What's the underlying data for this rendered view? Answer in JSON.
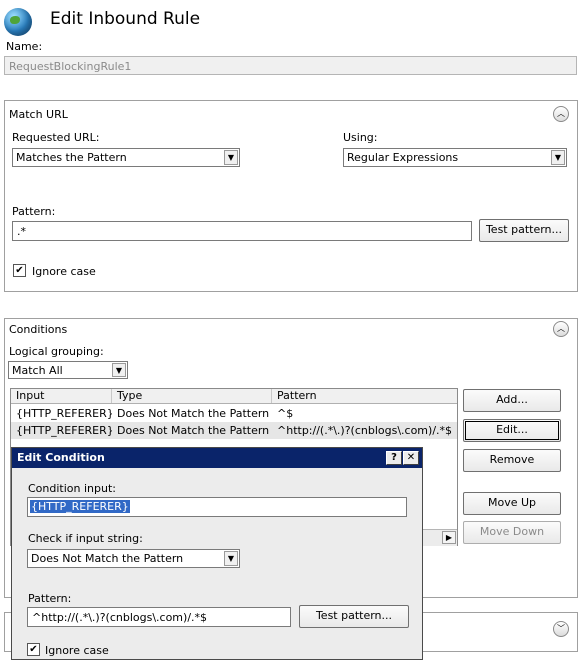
{
  "page": {
    "title": "Edit Inbound Rule",
    "name_label": "Name:",
    "name_value": "RequestBlockingRule1"
  },
  "match_url": {
    "header": "Match URL",
    "requested_url_label": "Requested URL:",
    "requested_url_value": "Matches the Pattern",
    "using_label": "Using:",
    "using_value": "Regular Expressions",
    "pattern_label": "Pattern:",
    "pattern_value": ".*",
    "test_pattern_button": "Test pattern...",
    "ignore_case_label": "Ignore case",
    "ignore_case_checked": true
  },
  "conditions": {
    "header": "Conditions",
    "logical_grouping_label": "Logical grouping:",
    "logical_grouping_value": "Match All",
    "columns": [
      "Input",
      "Type",
      "Pattern"
    ],
    "rows": [
      {
        "input": "{HTTP_REFERER}",
        "type": "Does Not Match the Pattern",
        "pattern": "^$"
      },
      {
        "input": "{HTTP_REFERER}",
        "type": "Does Not Match the Pattern",
        "pattern": "^http://(.*\\.)?(cnblogs\\.com)/.*$"
      }
    ],
    "buttons": {
      "add": "Add...",
      "edit": "Edit...",
      "remove": "Remove",
      "move_up": "Move Up",
      "move_down": "Move Down"
    }
  },
  "edit_condition_dialog": {
    "title": "Edit Condition",
    "help_glyph": "?",
    "close_glyph": "✕",
    "condition_input_label": "Condition input:",
    "condition_input_value": "{HTTP_REFERER}",
    "check_if_label": "Check if input string:",
    "check_if_value": "Does Not Match the Pattern",
    "pattern_label": "Pattern:",
    "pattern_value": "^http://(.*\\.)?(cnblogs\\.com)/.*$",
    "test_pattern_button": "Test pattern...",
    "ignore_case_label": "Ignore case",
    "ignore_case_checked": true
  },
  "icons": {
    "globe": "globe-icon",
    "collapse": "chevron-up-icon",
    "expand": "chevron-down-icon",
    "dropdown": "dropdown-arrow-icon",
    "check": "checkmark-icon"
  }
}
